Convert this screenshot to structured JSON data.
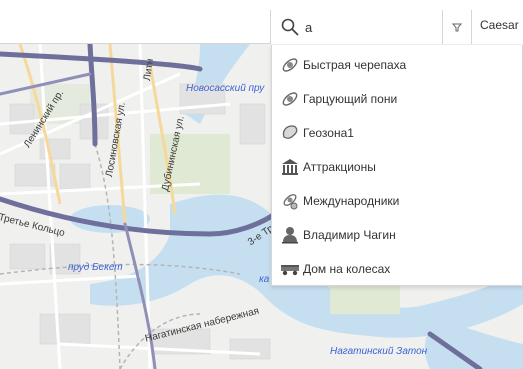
{
  "search": {
    "query": "а",
    "placeholder": ""
  },
  "header": {
    "account_label": "Caesar"
  },
  "map": {
    "labels": [
      {
        "text": "Новосасский пру",
        "kind": "water"
      },
      {
        "text": "Ленинский пр.",
        "kind": "street"
      },
      {
        "text": "Лосиновская ул.",
        "kind": "street"
      },
      {
        "text": "Дубининская ул.",
        "kind": "street"
      },
      {
        "text": "Литн",
        "kind": "street"
      },
      {
        "text": "Третье Кольцо",
        "kind": "street"
      },
      {
        "text": "пруд Бекет",
        "kind": "water"
      },
      {
        "text": "3-е Тр",
        "kind": "street"
      },
      {
        "text": "Нагатинская набережная",
        "kind": "street"
      },
      {
        "text": "Нагатинский Затон",
        "kind": "water"
      },
      {
        "text": "ка",
        "kind": "water"
      }
    ]
  },
  "dropdown": {
    "items": [
      {
        "label": "Быстрая черепаха",
        "icon": "satellite-icon"
      },
      {
        "label": "Гарцующий пони",
        "icon": "satellite-icon"
      },
      {
        "label": "Геозона1",
        "icon": "geofence-icon"
      },
      {
        "label": "Аттракционы",
        "icon": "building-icon"
      },
      {
        "label": "Международники",
        "icon": "satellite-group-icon"
      },
      {
        "label": "Владимир Чагин",
        "icon": "person-icon"
      },
      {
        "label": "Дом на колесах",
        "icon": "truck-icon"
      }
    ]
  },
  "colors": {
    "accent": "#3c63d6",
    "road_main": "#6f6f9c",
    "water": "#c6dff0"
  }
}
